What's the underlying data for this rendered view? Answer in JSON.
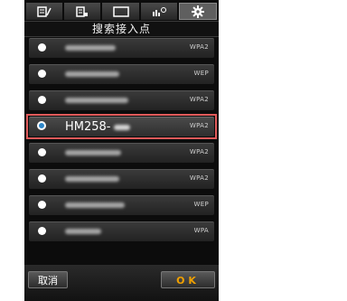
{
  "tabs": [
    {
      "icon": "pen-icon",
      "active": false
    },
    {
      "icon": "document-icon",
      "active": false
    },
    {
      "icon": "screen-icon",
      "active": false
    },
    {
      "icon": "scene-icon",
      "active": false
    },
    {
      "icon": "gear-icon",
      "active": true
    }
  ],
  "title": "搜索接入点",
  "networks": [
    {
      "ssid": "",
      "security": "WPA2",
      "selected": false
    },
    {
      "ssid": "",
      "security": "WEP",
      "selected": false
    },
    {
      "ssid": "",
      "security": "WPA2",
      "selected": false
    },
    {
      "ssid": "HM258-",
      "security": "WPA2",
      "selected": true
    },
    {
      "ssid": "",
      "security": "WPA2",
      "selected": false
    },
    {
      "ssid": "",
      "security": "WPA2",
      "selected": false
    },
    {
      "ssid": "",
      "security": "WEP",
      "selected": false
    },
    {
      "ssid": "",
      "security": "WPA",
      "selected": false
    }
  ],
  "buttons": {
    "cancel": "取消",
    "ok": "OK"
  },
  "colors": {
    "highlight": "#e05a5a",
    "selected_radio": "#2d86c9",
    "ok_text": "#f0a000"
  }
}
